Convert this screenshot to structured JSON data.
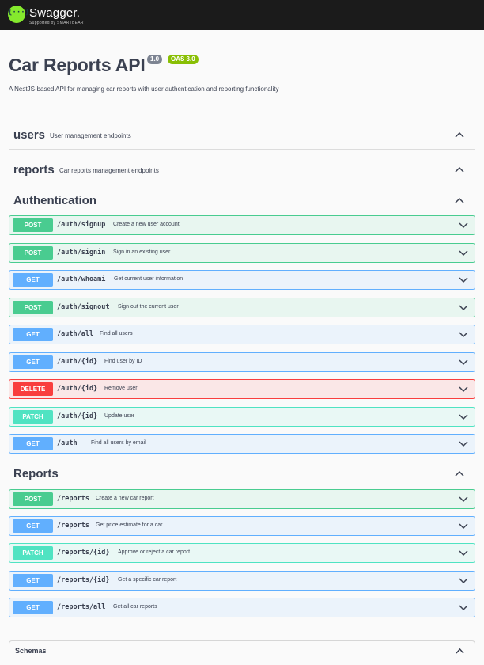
{
  "topbar": {
    "logo_glyph": "{···}",
    "brand": "Swagger.",
    "brand_sub": "Supported by SMARTBEAR"
  },
  "info": {
    "title": "Car Reports API",
    "version": "1.0",
    "oas": "OAS 3.0",
    "description": "A NestJS-based API for managing car reports with user authentication and reporting functionality"
  },
  "tags": {
    "users": {
      "name": "users",
      "description": "User management endpoints"
    },
    "reports": {
      "name": "reports",
      "description": "Car reports management endpoints"
    },
    "authentication": {
      "name": "Authentication"
    },
    "reports_section": {
      "name": "Reports"
    }
  },
  "auth_ops": [
    {
      "method": "POST",
      "path": "/auth/signup",
      "summary": "Create a new user account"
    },
    {
      "method": "POST",
      "path": "/auth/signin",
      "summary": "Sign in an existing user"
    },
    {
      "method": "GET",
      "path": "/auth/whoami",
      "summary": "Get current user information"
    },
    {
      "method": "POST",
      "path": "/auth/signout",
      "summary": "Sign out the current user"
    },
    {
      "method": "GET",
      "path": "/auth/all",
      "summary": "Find all users"
    },
    {
      "method": "GET",
      "path": "/auth/{id}",
      "summary": "Find user by ID"
    },
    {
      "method": "DELETE",
      "path": "/auth/{id}",
      "summary": "Remove user"
    },
    {
      "method": "PATCH",
      "path": "/auth/{id}",
      "summary": "Update user"
    },
    {
      "method": "GET",
      "path": "/auth",
      "summary": "Find all users by email"
    }
  ],
  "report_ops": [
    {
      "method": "POST",
      "path": "/reports",
      "summary": "Create a new car report"
    },
    {
      "method": "GET",
      "path": "/reports",
      "summary": "Get price estimate for a car"
    },
    {
      "method": "PATCH",
      "path": "/reports/{id}",
      "summary": "Approve or reject a car report"
    },
    {
      "method": "GET",
      "path": "/reports/{id}",
      "summary": "Get a specific car report"
    },
    {
      "method": "GET",
      "path": "/reports/all",
      "summary": "Get all car reports"
    }
  ],
  "schemas": {
    "title": "Schemas"
  },
  "colors": {
    "post": "#49cc90",
    "get": "#61affe",
    "delete": "#f93e3e",
    "patch": "#50e3c2",
    "topbar": "#1b1b1b",
    "swagger_green": "#85ea2d"
  }
}
